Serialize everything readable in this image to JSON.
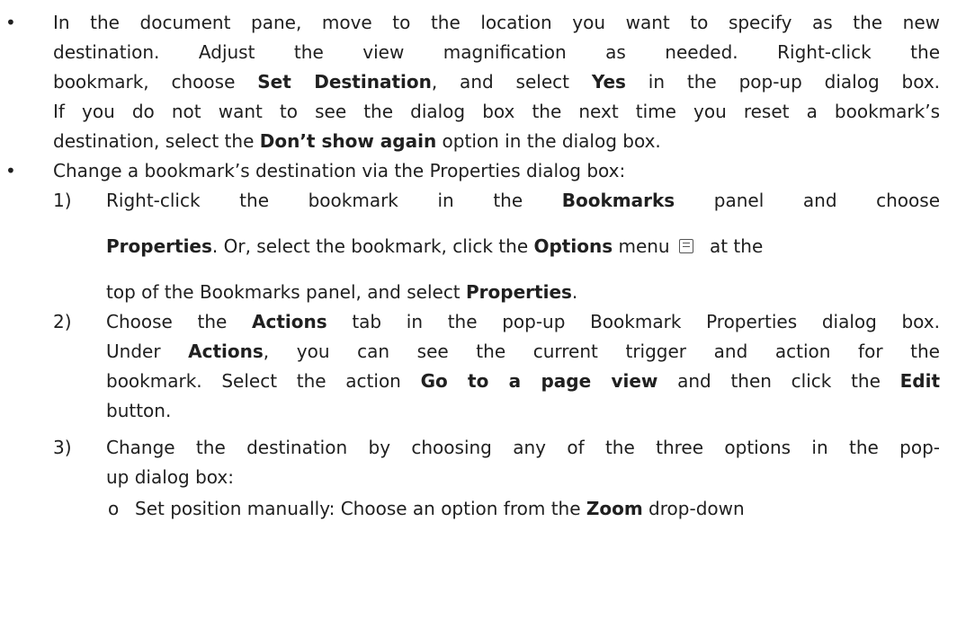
{
  "p1": {
    "l1": "In the document pane, move to the location you want to specify as the new",
    "l2": "destination. Adjust the view magnification as needed. Right-click the",
    "l3a": "bookmark, choose ",
    "l3b": "Set Destination",
    "l3c": ", and select ",
    "l3d": "Yes",
    "l3e": " in the pop-up dialog box.",
    "l4": "If you do not want to see the dialog box the next time you reset a bookmark’s",
    "l5a": "destination, select the ",
    "l5b": "Don’t show again",
    "l5c": " option in the dialog box."
  },
  "p2": {
    "l1": "Change a bookmark’s destination via the Properties dialog box:"
  },
  "s1": {
    "num": "1)",
    "l1a": "Right-click the bookmark in the ",
    "l1b": "Bookmarks",
    "l1c": " panel and choose",
    "l2a": "Properties",
    "l2b": ". Or, select the bookmark, click the ",
    "l2c": "Options",
    "l2d": " menu",
    "l2e": " at the",
    "l3a": "top of the Bookmarks panel, and select ",
    "l3b": "Properties",
    "l3c": "."
  },
  "s2": {
    "num": "2)",
    "l1a": "Choose the ",
    "l1b": "Actions",
    "l1c": " tab in the pop-up Bookmark Properties dialog box.",
    "l2a": "Under ",
    "l2b": "Actions",
    "l2c": ", you can see the current trigger and action for the",
    "l3a": "bookmark. Select the action ",
    "l3b": "Go to a page view",
    "l3c": " and then click the ",
    "l3d": "Edit",
    "l4": "button."
  },
  "s3": {
    "num": "3)",
    "l1": "Change the destination by choosing any of the three options in the pop-",
    "l2": "up dialog box:"
  },
  "sub1": {
    "mark": "o",
    "l1a": "Set position manually: Choose an option from the ",
    "l1b": "Zoom",
    "l1c": " drop-down"
  },
  "icons": {
    "options_menu": "list-menu-icon"
  }
}
